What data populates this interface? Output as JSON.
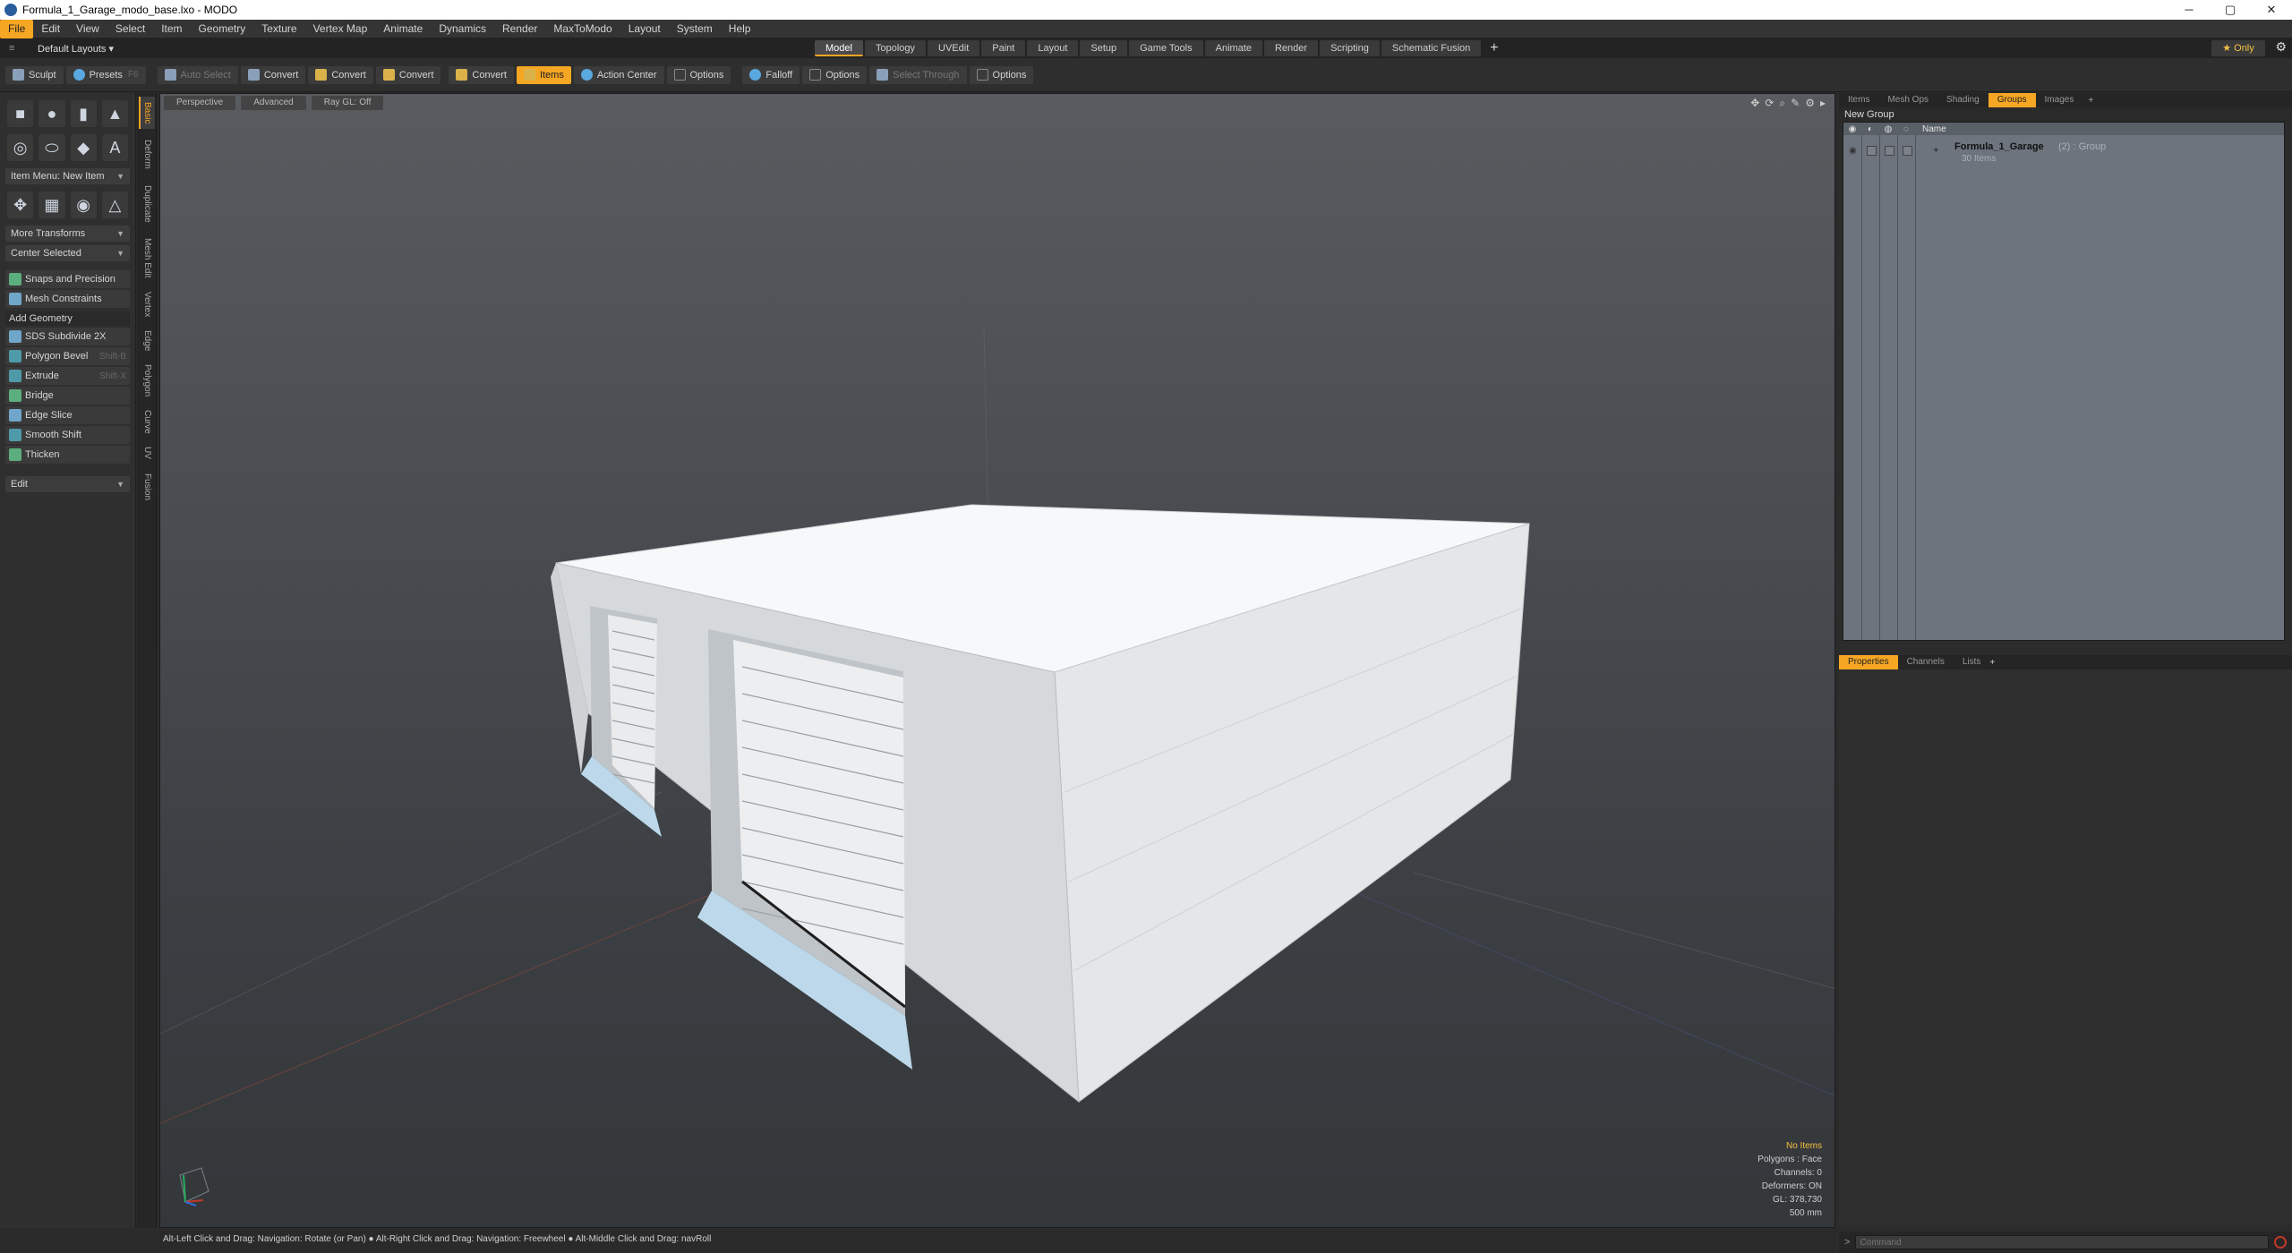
{
  "window": {
    "title": "Formula_1_Garage_modo_base.lxo - MODO",
    "minimize": "─",
    "maximize": "▢",
    "close": "✕"
  },
  "menu": [
    "File",
    "Edit",
    "View",
    "Select",
    "Item",
    "Geometry",
    "Texture",
    "Vertex Map",
    "Animate",
    "Dynamics",
    "Render",
    "MaxToModo",
    "Layout",
    "System",
    "Help"
  ],
  "layouts": {
    "selector": "Default Layouts ▾",
    "tabs": [
      "Model",
      "Topology",
      "UVEdit",
      "Paint",
      "Layout",
      "Setup",
      "Game Tools",
      "Animate",
      "Render",
      "Scripting",
      "Schematic Fusion"
    ],
    "active_tab": "Model",
    "only": "★ Only"
  },
  "toolbar": {
    "sculpt": "Sculpt",
    "presets": "Presets",
    "presets_key": "F6",
    "auto_select": "Auto Select",
    "convert1": "Convert",
    "convert2": "Convert",
    "convert3": "Convert",
    "convert4": "Convert",
    "items": "Items",
    "action_center": "Action Center",
    "options1": "Options",
    "falloff": "Falloff",
    "options2": "Options",
    "select_through": "Select Through",
    "options3": "Options"
  },
  "left": {
    "item_menu": "Item Menu: New Item",
    "more_transforms": "More Transforms",
    "center_selected": "Center Selected",
    "snaps": "Snaps and Precision",
    "mesh_constraints": "Mesh Constraints",
    "add_geometry": "Add Geometry",
    "tools": [
      {
        "label": "SDS Subdivide 2X",
        "key": ""
      },
      {
        "label": "Polygon Bevel",
        "key": "Shift-B"
      },
      {
        "label": "Extrude",
        "key": "Shift-X"
      },
      {
        "label": "Bridge",
        "key": ""
      },
      {
        "label": "Edge Slice",
        "key": ""
      },
      {
        "label": "Smooth Shift",
        "key": ""
      },
      {
        "label": "Thicken",
        "key": ""
      }
    ],
    "edit": "Edit"
  },
  "vtabs": [
    "Basic",
    "Deform",
    "Duplicate",
    "Mesh Edit",
    "Vertex",
    "Edge",
    "Polygon",
    "Curve",
    "UV",
    "Fusion"
  ],
  "viewport": {
    "perspective": "Perspective",
    "advanced": "Advanced",
    "raygl": "Ray GL: Off",
    "info": {
      "no_items": "No Items",
      "polygons": "Polygons : Face",
      "channels": "Channels: 0",
      "deformers": "Deformers: ON",
      "gl": "GL: 378,730",
      "scale": "500 mm"
    }
  },
  "right": {
    "tabs": [
      "Items",
      "Mesh Ops",
      "Shading",
      "Groups",
      "Images"
    ],
    "active_tab": "Groups",
    "new_group": "New Group",
    "name_col": "Name",
    "group": {
      "name": "Formula_1_Garage",
      "count": "(2) : Group",
      "sub": "30 Items"
    },
    "props_tabs": [
      "Properties",
      "Channels",
      "Lists"
    ],
    "command_placeholder": "Command"
  },
  "status": "Alt-Left Click and Drag: Navigation: Rotate (or Pan) ● Alt-Right Click and Drag: Navigation: Freewheel ● Alt-Middle Click and Drag: navRoll"
}
